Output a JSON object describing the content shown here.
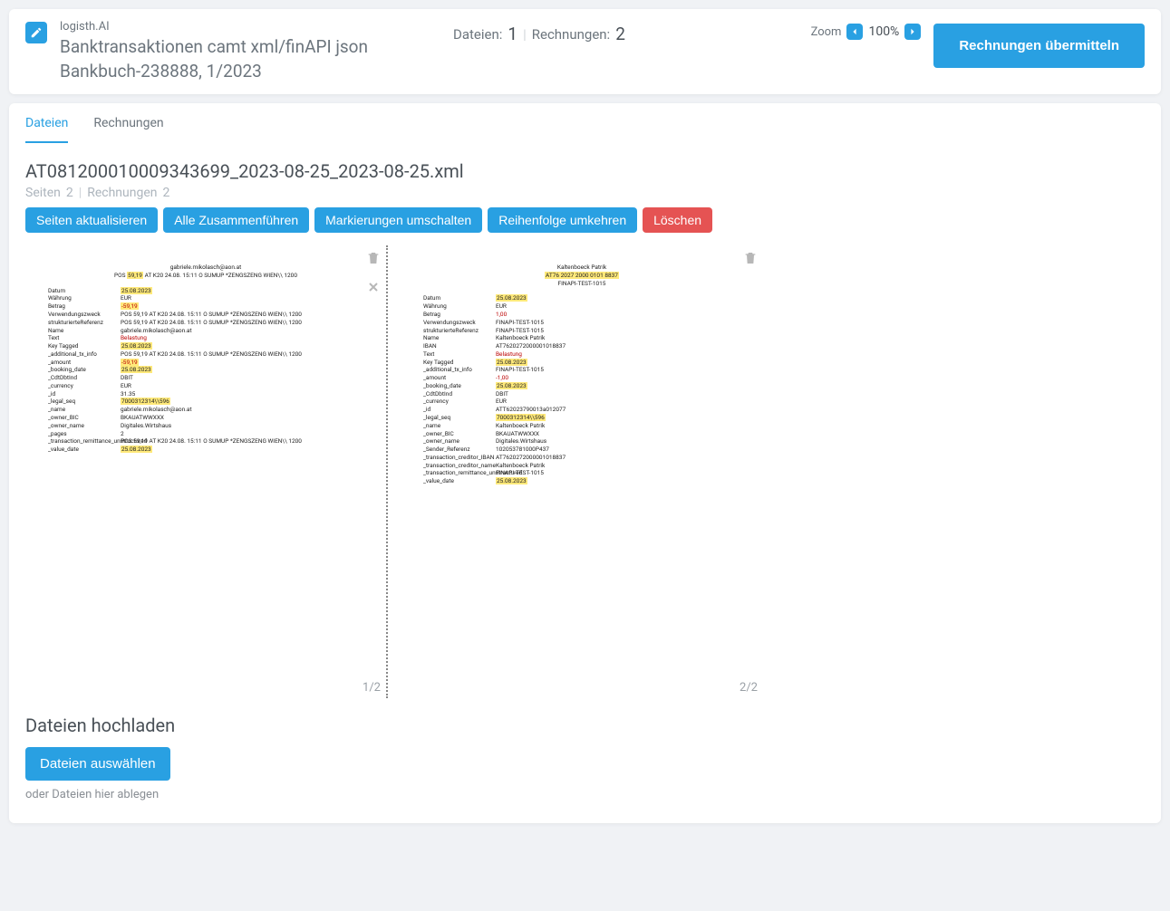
{
  "header": {
    "brand": "logisth.AI",
    "title": "Banktransaktionen camt xml/finAPI json Bankbuch-238888, 1/2023",
    "counts": {
      "files_label": "Dateien:",
      "files_value": "1",
      "invoices_label": "Rechnungen:",
      "invoices_value": "2"
    },
    "zoom": {
      "label": "Zoom",
      "value": "100%"
    },
    "submit_label": "Rechnungen übermitteln"
  },
  "tabs": {
    "files": "Dateien",
    "invoices": "Rechnungen"
  },
  "file": {
    "name": "AT081200010009343699_2023-08-25_2023-08-25.xml",
    "sub_pages_label": "Seiten",
    "sub_pages_value": "2",
    "sub_inv_label": "Rechnungen",
    "sub_inv_value": "2",
    "actions": {
      "refresh": "Seiten aktualisieren",
      "merge": "Alle Zusammenführen",
      "toggle_marks": "Markierungen umschalten",
      "reverse": "Reihenfolge umkehren",
      "delete": "Löschen"
    }
  },
  "pages": {
    "p1": {
      "num": "1/2",
      "header_line1": "gabriele.mikolasch@aon.at",
      "header_line2_pre": "POS ",
      "header_line2_hl": "59,19",
      "header_line2_post": " AT K20 24.08. 15:11 O SUMUP *ZENGSZENG WIEN\\\\ 1200",
      "rows": [
        {
          "k": "Datum",
          "v": "25.08.2023",
          "hl": true
        },
        {
          "k": "Währung",
          "v": "EUR"
        },
        {
          "k": "Betrag",
          "v": "-59,19",
          "hl": true,
          "red": true
        },
        {
          "k": "Verwendungszweck",
          "v": "POS 59,19 AT K20 24.08. 15:11 O SUMUP *ZENGSZENG WIEN\\\\ 1200"
        },
        {
          "k": "strukturierteReferenz",
          "v": "POS 59,19 AT K20 24.08. 15:11 O SUMUP *ZENGSZENG WIEN\\\\ 1200"
        },
        {
          "k": "Name",
          "v": "gabriele.mikolasch@aon.at"
        },
        {
          "k": "Text",
          "v": "Belastung",
          "red": true
        },
        {
          "k": "Key Tagged",
          "v": "25.08.2023",
          "hl": true
        },
        {
          "k": "_additional_tx_info",
          "v": "POS 59,19 AT K20 24.08. 15:11 O SUMUP *ZENGSZENG WIEN\\\\ 1200"
        },
        {
          "k": "_amount",
          "v": "-59,19",
          "hl": true,
          "red": true
        },
        {
          "k": "_booking_date",
          "v": "25.08.2023",
          "hl": true
        },
        {
          "k": "_CdtDbtInd",
          "v": "DBIT"
        },
        {
          "k": "_currency",
          "v": "EUR"
        },
        {
          "k": "_id",
          "v": "31.35"
        },
        {
          "k": "_legal_seq",
          "v": "7000312314\\\\596",
          "hl": true
        },
        {
          "k": "_name",
          "v": "gabriele.mikolasch@aon.at"
        },
        {
          "k": "_owner_BIC",
          "v": "BKAUATWWXXX"
        },
        {
          "k": "_owner_name",
          "v": "Digitales.Wirtshaus"
        },
        {
          "k": "_pages",
          "v": "2"
        },
        {
          "k": "_transaction_remittance_unstructured",
          "v": "POS 59,19 AT K20 24.08. 15:11 O SUMUP *ZENGSZENG WIEN\\\\ 1200"
        },
        {
          "k": "_value_date",
          "v": "25.08.2023",
          "hl": true
        }
      ]
    },
    "p2": {
      "num": "2/2",
      "header_line1": "Kaltenboeck Patrik",
      "header_line2": "AT76 2027 2000 0101 8837",
      "header_line3": "FINAPI-TEST-1015",
      "rows": [
        {
          "k": "Datum",
          "v": "25.08.2023",
          "hl": true
        },
        {
          "k": "Währung",
          "v": "EUR"
        },
        {
          "k": "Betrag",
          "v": "1,00",
          "red": true
        },
        {
          "k": "Verwendungszweck",
          "v": "FINAPI-TEST-1015"
        },
        {
          "k": "strukturierteReferenz",
          "v": "FINAPI-TEST-1015"
        },
        {
          "k": "Name",
          "v": "Kaltenboeck Patrik"
        },
        {
          "k": "IBAN",
          "v": "AT7620272000001018837"
        },
        {
          "k": "Text",
          "v": "Belastung",
          "red": true
        },
        {
          "k": "Key Tagged",
          "v": "25.08.2023",
          "hl": true
        },
        {
          "k": "_additional_tx_info",
          "v": "FINAPI-TEST-1015"
        },
        {
          "k": "_amount",
          "v": "-1,00",
          "red": true
        },
        {
          "k": "_booking_date",
          "v": "25.08.2023",
          "hl": true
        },
        {
          "k": "_CdtDbtInd",
          "v": "DBIT"
        },
        {
          "k": "_currency",
          "v": "EUR"
        },
        {
          "k": "_id",
          "v": "ATT62023790013a012077"
        },
        {
          "k": "_legal_seq",
          "v": "7000312314\\\\596",
          "hl": true
        },
        {
          "k": "_name",
          "v": "Kaltenboeck Patrik"
        },
        {
          "k": "_owner_BIC",
          "v": "BKAUATWWXXX"
        },
        {
          "k": "_owner_name",
          "v": "Digitales.Wirtshaus"
        },
        {
          "k": "_Sender_Referenz",
          "v": "102053781000P437"
        },
        {
          "k": "_transaction_creditor_IBAN",
          "v": "AT7620272000001018837"
        },
        {
          "k": "_transaction_creditor_name",
          "v": "Kaltenboeck Patrik"
        },
        {
          "k": "_transaction_remittance_unstructured",
          "v": "FINAPI-TEST-1015"
        },
        {
          "k": "_value_date",
          "v": "25.08.2023",
          "hl": true
        }
      ]
    }
  },
  "upload": {
    "title": "Dateien hochladen",
    "select": "Dateien auswählen",
    "hint": "oder Dateien hier ablegen"
  }
}
